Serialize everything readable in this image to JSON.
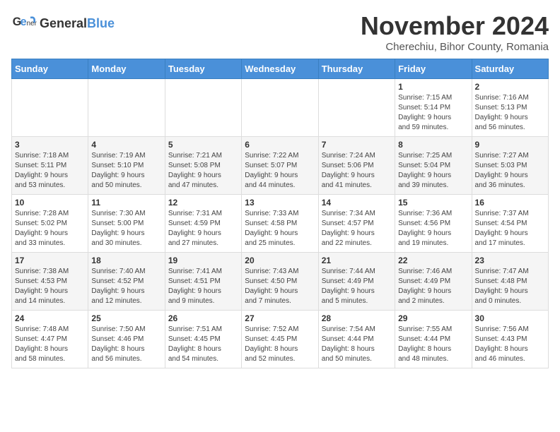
{
  "logo": {
    "line1": "General",
    "line2": "Blue"
  },
  "title": "November 2024",
  "subtitle": "Cherechiu, Bihor County, Romania",
  "headers": [
    "Sunday",
    "Monday",
    "Tuesday",
    "Wednesday",
    "Thursday",
    "Friday",
    "Saturday"
  ],
  "weeks": [
    [
      {
        "day": "",
        "info": ""
      },
      {
        "day": "",
        "info": ""
      },
      {
        "day": "",
        "info": ""
      },
      {
        "day": "",
        "info": ""
      },
      {
        "day": "",
        "info": ""
      },
      {
        "day": "1",
        "info": "Sunrise: 7:15 AM\nSunset: 5:14 PM\nDaylight: 9 hours\nand 59 minutes."
      },
      {
        "day": "2",
        "info": "Sunrise: 7:16 AM\nSunset: 5:13 PM\nDaylight: 9 hours\nand 56 minutes."
      }
    ],
    [
      {
        "day": "3",
        "info": "Sunrise: 7:18 AM\nSunset: 5:11 PM\nDaylight: 9 hours\nand 53 minutes."
      },
      {
        "day": "4",
        "info": "Sunrise: 7:19 AM\nSunset: 5:10 PM\nDaylight: 9 hours\nand 50 minutes."
      },
      {
        "day": "5",
        "info": "Sunrise: 7:21 AM\nSunset: 5:08 PM\nDaylight: 9 hours\nand 47 minutes."
      },
      {
        "day": "6",
        "info": "Sunrise: 7:22 AM\nSunset: 5:07 PM\nDaylight: 9 hours\nand 44 minutes."
      },
      {
        "day": "7",
        "info": "Sunrise: 7:24 AM\nSunset: 5:06 PM\nDaylight: 9 hours\nand 41 minutes."
      },
      {
        "day": "8",
        "info": "Sunrise: 7:25 AM\nSunset: 5:04 PM\nDaylight: 9 hours\nand 39 minutes."
      },
      {
        "day": "9",
        "info": "Sunrise: 7:27 AM\nSunset: 5:03 PM\nDaylight: 9 hours\nand 36 minutes."
      }
    ],
    [
      {
        "day": "10",
        "info": "Sunrise: 7:28 AM\nSunset: 5:02 PM\nDaylight: 9 hours\nand 33 minutes."
      },
      {
        "day": "11",
        "info": "Sunrise: 7:30 AM\nSunset: 5:00 PM\nDaylight: 9 hours\nand 30 minutes."
      },
      {
        "day": "12",
        "info": "Sunrise: 7:31 AM\nSunset: 4:59 PM\nDaylight: 9 hours\nand 27 minutes."
      },
      {
        "day": "13",
        "info": "Sunrise: 7:33 AM\nSunset: 4:58 PM\nDaylight: 9 hours\nand 25 minutes."
      },
      {
        "day": "14",
        "info": "Sunrise: 7:34 AM\nSunset: 4:57 PM\nDaylight: 9 hours\nand 22 minutes."
      },
      {
        "day": "15",
        "info": "Sunrise: 7:36 AM\nSunset: 4:56 PM\nDaylight: 9 hours\nand 19 minutes."
      },
      {
        "day": "16",
        "info": "Sunrise: 7:37 AM\nSunset: 4:54 PM\nDaylight: 9 hours\nand 17 minutes."
      }
    ],
    [
      {
        "day": "17",
        "info": "Sunrise: 7:38 AM\nSunset: 4:53 PM\nDaylight: 9 hours\nand 14 minutes."
      },
      {
        "day": "18",
        "info": "Sunrise: 7:40 AM\nSunset: 4:52 PM\nDaylight: 9 hours\nand 12 minutes."
      },
      {
        "day": "19",
        "info": "Sunrise: 7:41 AM\nSunset: 4:51 PM\nDaylight: 9 hours\nand 9 minutes."
      },
      {
        "day": "20",
        "info": "Sunrise: 7:43 AM\nSunset: 4:50 PM\nDaylight: 9 hours\nand 7 minutes."
      },
      {
        "day": "21",
        "info": "Sunrise: 7:44 AM\nSunset: 4:49 PM\nDaylight: 9 hours\nand 5 minutes."
      },
      {
        "day": "22",
        "info": "Sunrise: 7:46 AM\nSunset: 4:49 PM\nDaylight: 9 hours\nand 2 minutes."
      },
      {
        "day": "23",
        "info": "Sunrise: 7:47 AM\nSunset: 4:48 PM\nDaylight: 9 hours\nand 0 minutes."
      }
    ],
    [
      {
        "day": "24",
        "info": "Sunrise: 7:48 AM\nSunset: 4:47 PM\nDaylight: 8 hours\nand 58 minutes."
      },
      {
        "day": "25",
        "info": "Sunrise: 7:50 AM\nSunset: 4:46 PM\nDaylight: 8 hours\nand 56 minutes."
      },
      {
        "day": "26",
        "info": "Sunrise: 7:51 AM\nSunset: 4:45 PM\nDaylight: 8 hours\nand 54 minutes."
      },
      {
        "day": "27",
        "info": "Sunrise: 7:52 AM\nSunset: 4:45 PM\nDaylight: 8 hours\nand 52 minutes."
      },
      {
        "day": "28",
        "info": "Sunrise: 7:54 AM\nSunset: 4:44 PM\nDaylight: 8 hours\nand 50 minutes."
      },
      {
        "day": "29",
        "info": "Sunrise: 7:55 AM\nSunset: 4:44 PM\nDaylight: 8 hours\nand 48 minutes."
      },
      {
        "day": "30",
        "info": "Sunrise: 7:56 AM\nSunset: 4:43 PM\nDaylight: 8 hours\nand 46 minutes."
      }
    ]
  ]
}
